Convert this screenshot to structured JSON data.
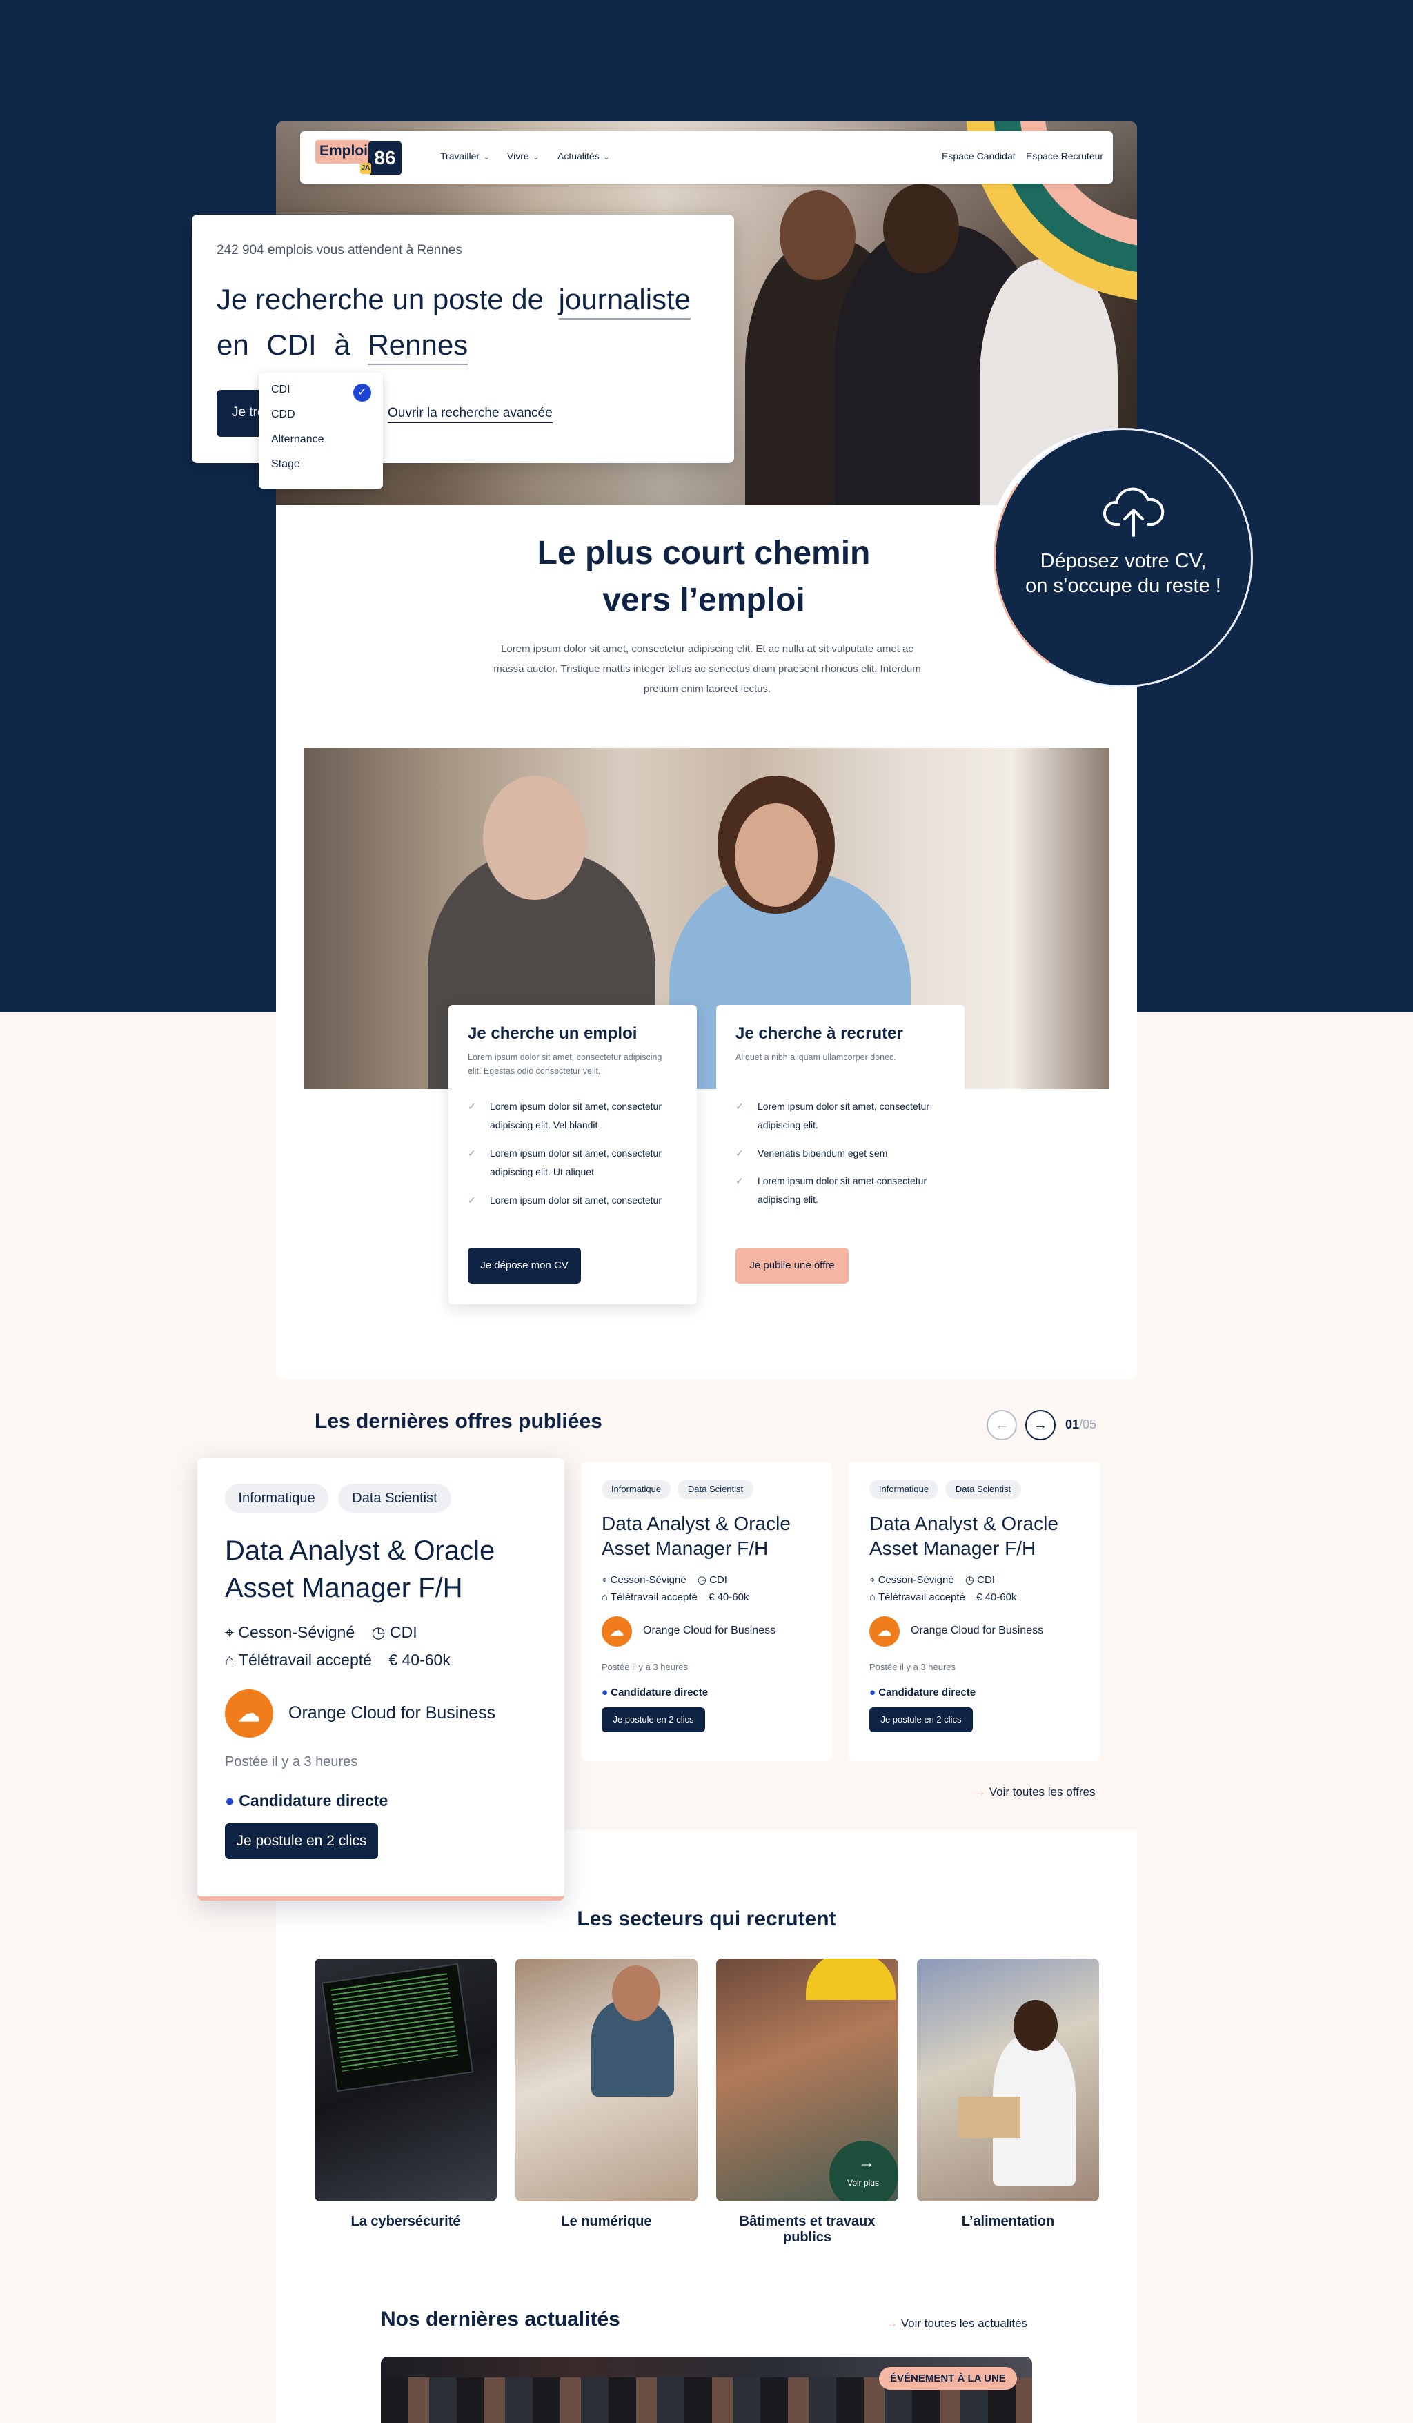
{
  "brand": {
    "logo_word": "Emploi",
    "logo_number": "86",
    "logo_tag": "JA"
  },
  "nav": {
    "items": [
      {
        "label": "Travailler"
      },
      {
        "label": "Vivre"
      },
      {
        "label": "Actualités"
      }
    ],
    "candidate": "Espace Candidat",
    "recruiter": "Espace Recruteur"
  },
  "search": {
    "count_text": "242 904 emplois vous attendent à Rennes",
    "line1_prefix": "Je recherche un poste de",
    "job_value": "journaliste",
    "line2_prefix": "en",
    "contract_value": "CDI",
    "connector": "à",
    "city_value": "Rennes",
    "button_label": "Je trouve",
    "advanced_link": "Ouvrir la recherche avancée",
    "dropdown_options": [
      "CDI",
      "CDD",
      "Alternance",
      "Stage"
    ],
    "selected_option": "CDI"
  },
  "cv_upload": {
    "line1": "Déposez votre CV,",
    "line2": "on s’occupe du reste !"
  },
  "headline": {
    "line1": "Le plus court chemin",
    "line2": "vers l’emploi"
  },
  "intro_text": "Lorem ipsum dolor sit amet, consectetur adipiscing elit. Et ac nulla at sit vulputate amet ac massa auctor. Tristique mattis integer tellus ac senectus diam praesent rhoncus elit. Interdum pretium enim laoreet lectus.",
  "cards": {
    "seeker": {
      "title": "Je cherche un emploi",
      "subtitle": "Lorem ipsum dolor sit amet, consectetur adipiscing elit. Egestas odio consectetur velit.",
      "items": [
        "Lorem ipsum dolor sit amet, consectetur adipiscing elit. Vel blandit",
        "Lorem ipsum dolor sit amet, consectetur adipiscing elit. Ut aliquet",
        "Lorem ipsum dolor sit amet, consectetur"
      ],
      "button": "Je dépose mon CV"
    },
    "recruiter": {
      "title": "Je cherche à recruter",
      "subtitle": "Aliquet a nibh aliquam ullamcorper donec.",
      "items": [
        "Lorem ipsum dolor sit amet, consectetur adipiscing elit.",
        "Venenatis bibendum eget sem",
        "Lorem ipsum dolor sit amet consectetur adipiscing elit."
      ],
      "button": "Je publie une offre"
    }
  },
  "offers": {
    "title": "Les dernières offres publiées",
    "pager_current": "01",
    "pager_total": "/05",
    "see_all": "Voir toutes les offres",
    "items": [
      {
        "tags": [
          "Informatique",
          "Data Scientist"
        ],
        "title_line1": "Data Analyst & Oracle",
        "title_line2": "Asset Manager F/H",
        "location": "Cesson-Sévigné",
        "contract": "CDI",
        "remote": "Télétravail accepté",
        "salary": "40-60k",
        "company": "Orange Cloud for Business",
        "posted": "Postée il y a 3 heures",
        "apply_type": "Candidature directe",
        "button": "Je postule en 2 clics"
      },
      {
        "tags": [
          "Informatique",
          "Data Scientist"
        ],
        "title_line1": "Data Analyst & Oracle",
        "title_line2": "Asset Manager F/H",
        "location": "Cesson-Sévigné",
        "contract": "CDI",
        "remote": "Télétravail accepté",
        "salary": "40-60k",
        "company": "Orange Cloud for Business",
        "posted": "Postée il y a 3 heures",
        "apply_type": "Candidature directe",
        "button": "Je postule en 2 clics"
      },
      {
        "tags": [
          "Informatique",
          "Data Scientist"
        ],
        "title_line1": "Data Analyst & Oracle",
        "title_line2": "Asset Manager F/H",
        "location": "Cesson-Sévigné",
        "contract": "CDI",
        "remote": "Télétravail accepté",
        "salary": "40-60k",
        "company": "Orange Cloud for Business",
        "posted": "Postée il y a 3 heures",
        "apply_type": "Candidature directe",
        "button": "Je postule en 2 clics"
      }
    ]
  },
  "sectors": {
    "title": "Les secteurs qui recrutent",
    "items": [
      {
        "label": "La cybersécurité"
      },
      {
        "label": "Le numérique"
      },
      {
        "label": "Bâtiments et travaux publics"
      },
      {
        "label": "L’alimentation"
      }
    ],
    "see_more": "Voir plus"
  },
  "news": {
    "title": "Nos dernières actualités",
    "see_all": "Voir toutes les actualités",
    "badge": "ÉVÉNEMENT À LA UNE"
  },
  "colors": {
    "navy": "#0f2848",
    "peach": "#f5b5a3",
    "accent_blue": "#1e45d6",
    "orange": "#f07c1b",
    "teal": "#1d6b5f",
    "yellow": "#f5c84b"
  }
}
